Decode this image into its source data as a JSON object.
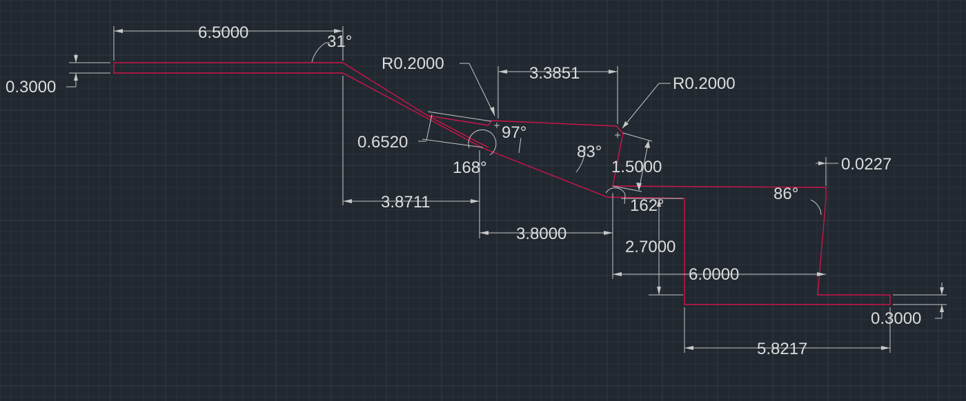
{
  "drawing": {
    "colors": {
      "background": "#212830",
      "geometry": "#d0144a",
      "dimension": "#c8c8c8"
    },
    "dimensions": {
      "top_length": "6.5000",
      "left_thickness": "0.3000",
      "bend_angle_top": "31°",
      "radius_upper_left": "R0.2000",
      "radius_upper_right": "R0.2000",
      "top_span": "3.3851",
      "angle_97": "97°",
      "slot_width": "0.6520",
      "angle_168": "168°",
      "angle_83": "83°",
      "height_1_5": "1.5000",
      "offset_right": "0.0227",
      "angle_86": "86°",
      "horizontal_3_8711": "3.8711",
      "angle_162": "162°",
      "horizontal_3_8": "3.8000",
      "height_2_7": "2.7000",
      "width_6": "6.0000",
      "right_thickness": "0.3000",
      "bottom_length": "5.8217"
    }
  }
}
